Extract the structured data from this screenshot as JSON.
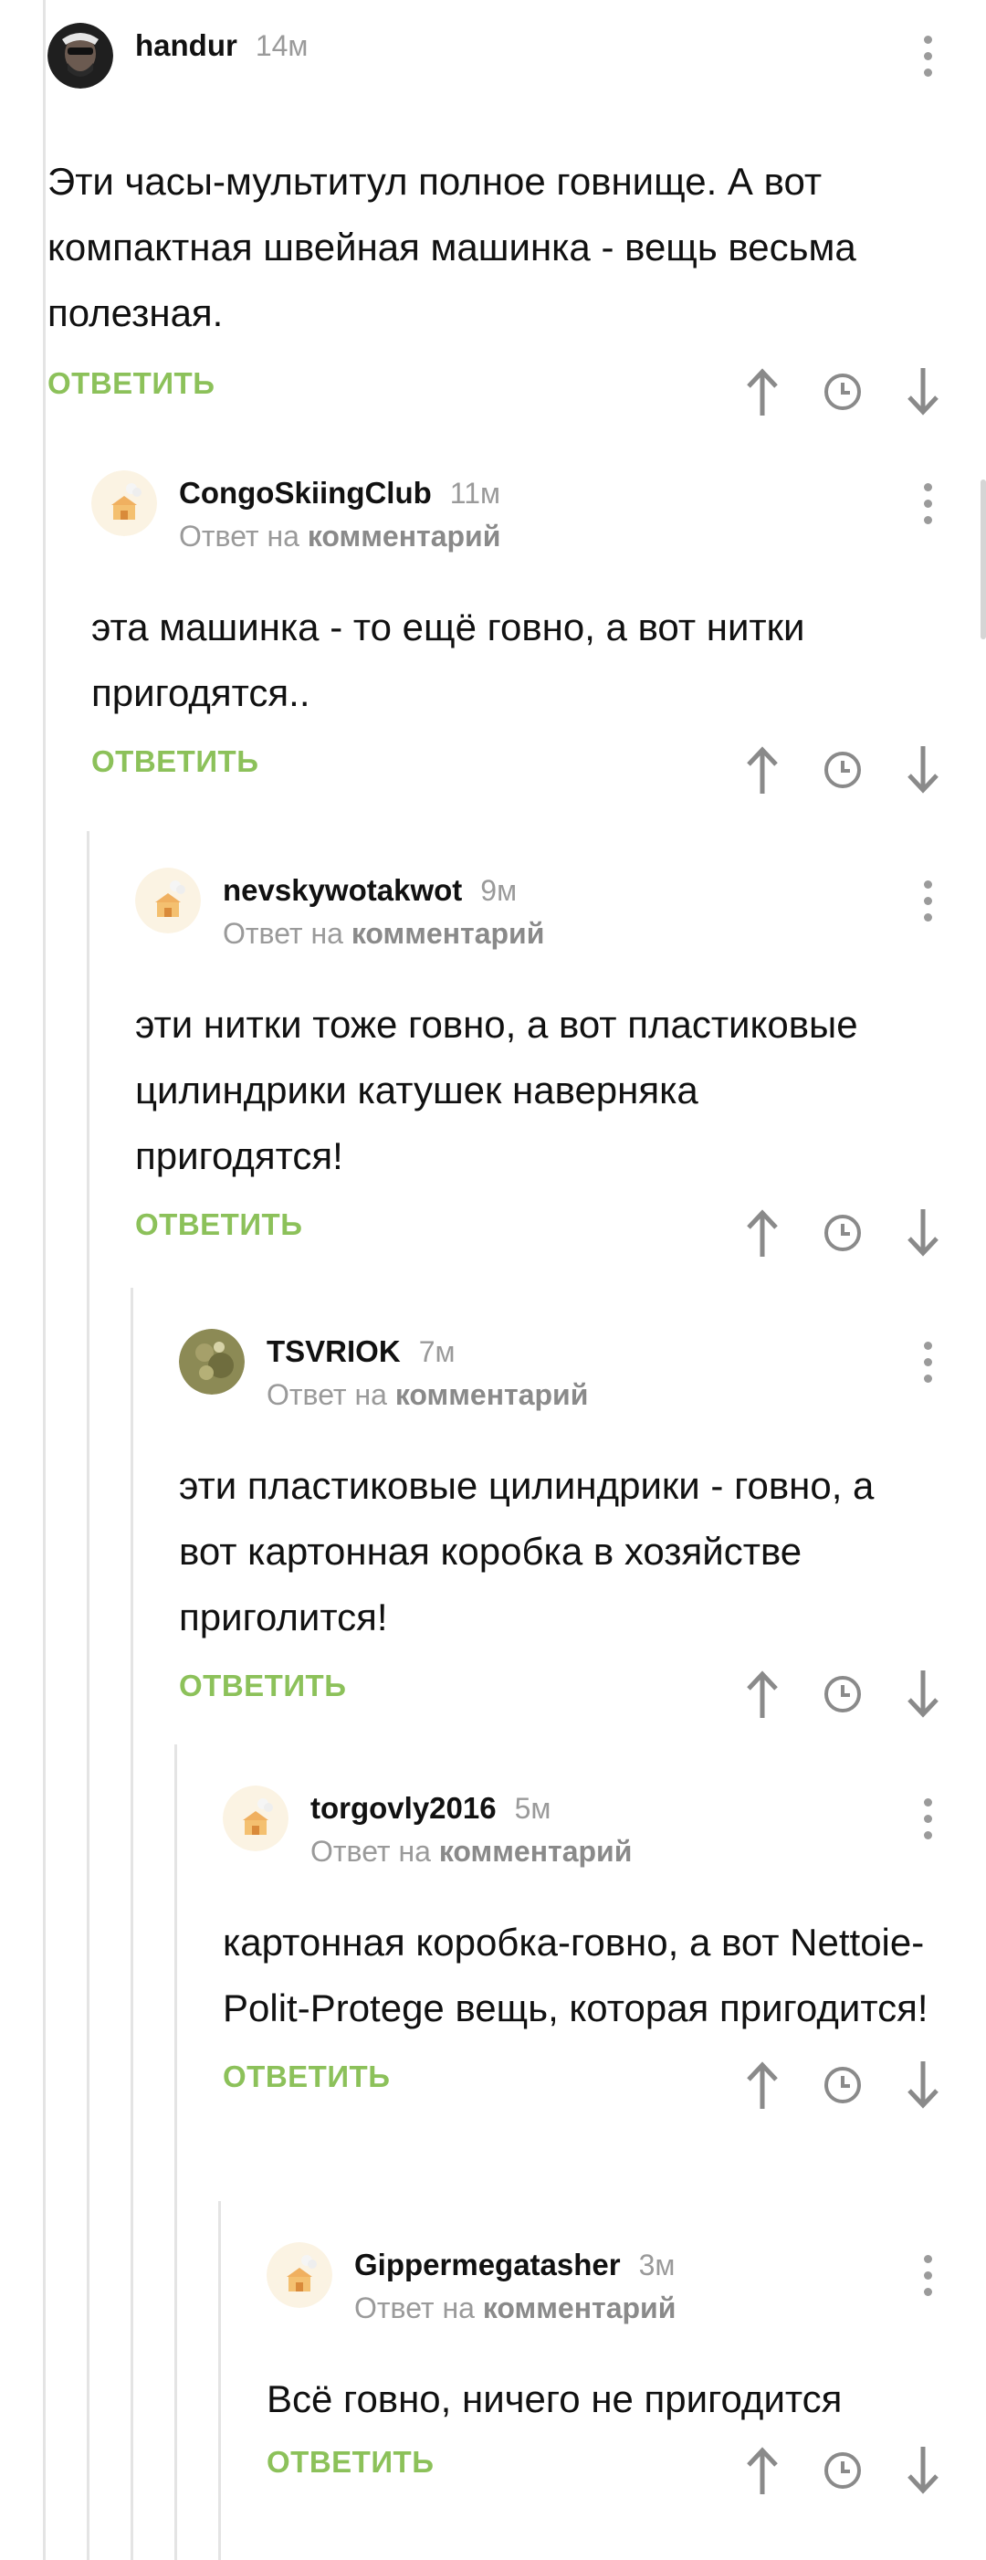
{
  "colors": {
    "accent": "#8cc15a",
    "muted": "#9a9a9a",
    "text": "#111111",
    "line": "#e4e4e4"
  },
  "comments": [
    {
      "user": "handur",
      "time": "14м",
      "reply_prefix": "",
      "reply_link": "",
      "text": "Эти часы-мультитул полное говнище. А вот компактная швейная машинка - вещь весьма полезная.",
      "reply_label": "ОТВЕТИТЬ",
      "avatar": "photo-avatar-dark"
    },
    {
      "user": "CongoSkiingClub",
      "time": "11м",
      "reply_prefix": "Ответ на",
      "reply_link": "комментарий",
      "text": "эта машинка - то ещё говно, а вот нитки пригодятся..",
      "reply_label": "ОТВЕТИТЬ",
      "avatar": "default-house-avatar"
    },
    {
      "user": "nevskywotakwot",
      "time": "9м",
      "reply_prefix": "Ответ на",
      "reply_link": "комментарий",
      "text": "эти нитки тоже говно, а вот пластиковые цилиндрики катушек наверняка пригодятся!",
      "reply_label": "ОТВЕТИТЬ",
      "avatar": "default-house-avatar"
    },
    {
      "user": "TSVRIOK",
      "time": "7м",
      "reply_prefix": "Ответ на",
      "reply_link": "комментарий",
      "text": "эти пластиковые цилиндрики - говно, а вот картонная коробка в хозяйстве приголится!",
      "reply_label": "ОТВЕТИТЬ",
      "avatar": "photo-avatar-green"
    },
    {
      "user": "torgovly2016",
      "time": "5м",
      "reply_prefix": "Ответ на",
      "reply_link": "комментарий",
      "text": "картонная коробка-говно, а вот Nettoie-Polit-Protege вещь, которая пригодится!",
      "reply_label": "ОТВЕТИТЬ",
      "avatar": "default-house-avatar"
    },
    {
      "user": "Gippermegatasher",
      "time": "3м",
      "reply_prefix": "Ответ на",
      "reply_link": "комментарий",
      "text": "Всё говно, ничего не пригодится",
      "reply_label": "ОТВЕТИТЬ",
      "avatar": "default-house-avatar"
    }
  ],
  "icons": {
    "upvote": "arrow-up-icon",
    "save": "clock-icon",
    "downvote": "arrow-down-icon",
    "menu": "more-vertical-icon"
  }
}
